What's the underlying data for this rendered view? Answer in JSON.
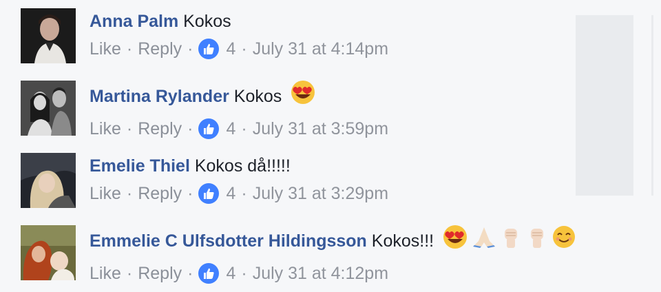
{
  "comments": [
    {
      "author": "Anna Palm",
      "text": "Kokos",
      "emojis": [],
      "actions": {
        "like": "Like",
        "reply": "Reply"
      },
      "reaction_count": "4",
      "timestamp": "July 31 at 4:14pm"
    },
    {
      "author": "Martina Rylander",
      "text": "Kokos",
      "emojis": [
        "heart-eyes-emoji"
      ],
      "actions": {
        "like": "Like",
        "reply": "Reply"
      },
      "reaction_count": "4",
      "timestamp": "July 31 at 3:59pm"
    },
    {
      "author": "Emelie Thiel",
      "text": "Kokos då!!!!!",
      "emojis": [],
      "actions": {
        "like": "Like",
        "reply": "Reply"
      },
      "reaction_count": "4",
      "timestamp": "July 31 at 3:29pm"
    },
    {
      "author": "Emmelie C Ulfsdotter Hildingsson",
      "text": "Kokos!!!",
      "emojis": [
        "heart-eyes-emoji",
        "folded-hands-emoji",
        "raised-fist-emoji",
        "raised-fist-emoji",
        "smiling-emoji"
      ],
      "actions": {
        "like": "Like",
        "reply": "Reply"
      },
      "reaction_count": "4",
      "timestamp": "July 31 at 4:12pm"
    }
  ],
  "colors": {
    "author": "#365899",
    "meta": "#90949c",
    "like_badge": "#4080ff",
    "background": "#f6f7f9"
  }
}
